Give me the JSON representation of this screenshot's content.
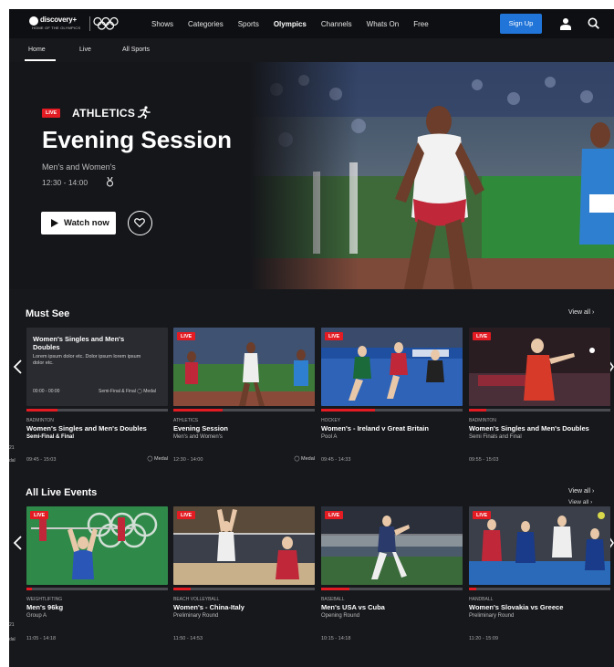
{
  "brand": {
    "name": "discovery+",
    "tagline": "HOME OF THE OLYMPICS"
  },
  "nav": {
    "links": [
      "Shows",
      "Categories",
      "Sports",
      "Olympics",
      "Channels",
      "Whats On",
      "Free"
    ],
    "active": "Olympics",
    "signup_label": "Sign Up"
  },
  "subnav": {
    "tabs": [
      "Home",
      "Live",
      "All Sports"
    ],
    "active": "Home"
  },
  "hero": {
    "live_label": "LIVE",
    "sport": "ATHLETICS",
    "title": "Evening Session",
    "subtitle": "Men's and Women's",
    "time": "12:30 - 14:00",
    "watch_label": "Watch now"
  },
  "must_see": {
    "title": "Must See",
    "view_all": "View all",
    "edge_left_texts": [
      "21",
      "dal"
    ],
    "cards": [
      {
        "live": false,
        "overlay_title": "Women's Singles and Men's Doubles",
        "overlay_desc": "Lorem ipsum dolor etc. Dolor ipsum lorem ipsum dolor etc.",
        "overlay_time": "00:00 - 00:00",
        "overlay_round": "Semi-Final & Final",
        "overlay_medal": "Medal",
        "sport": "BADMINTON",
        "title": "Women's Singles and Men's Doubles",
        "subtitle": "Semi-Final & Final",
        "time": "09:45 - 15:03",
        "medal": "Medal",
        "progress": 0.22
      },
      {
        "live": true,
        "live_label": "LIVE",
        "sport": "ATHLETICS",
        "title": "Evening Session",
        "subtitle": "Men's and Women's",
        "time": "12:30 - 14:00",
        "medal": "Medal",
        "progress": 0.35
      },
      {
        "live": true,
        "live_label": "LIVE",
        "sport": "HOCKEY",
        "title": "Women's - Ireland v Great Britain",
        "subtitle": "Pool A",
        "time": "09:45 - 14:33",
        "medal": "",
        "progress": 0.38
      },
      {
        "live": true,
        "live_label": "LIVE",
        "sport": "BADMINTON",
        "title": "Women's Singles and Men's Doubles",
        "subtitle": "Semi Finals and Final",
        "time": "09:55 - 15:03",
        "medal": "",
        "progress": 0.12
      }
    ]
  },
  "all_live": {
    "title": "All Live Events",
    "view_all": "View all",
    "view_all_ghost": "View all",
    "edge_left_texts": [
      "21",
      "dal"
    ],
    "cards": [
      {
        "live_label": "LIVE",
        "sport": "WEIGHTLIFTING",
        "title": "Men's 96kg",
        "subtitle": "Group A",
        "time": "11:05 - 14:18",
        "progress": 0.04
      },
      {
        "live_label": "LIVE",
        "sport": "BEACH VOLLEYBALL",
        "title": "Women's - China-Italy",
        "subtitle": "Preliminary Round",
        "time": "11:50 - 14:53",
        "progress": 0.12
      },
      {
        "live_label": "LIVE",
        "sport": "BASEBALL",
        "title": "Men's USA vs Cuba",
        "subtitle": "Opening Round",
        "time": "10:15 - 14:18",
        "progress": 0.2
      },
      {
        "live_label": "LIVE",
        "sport": "HANDBALL",
        "title": "Women's Slovakia vs Greece",
        "subtitle": "Preliminary Round",
        "time": "11:20 - 15:09",
        "progress": 0.05
      }
    ]
  },
  "colors": {
    "background": "#17181c",
    "live_red": "#e31b23",
    "signup_blue": "#2175d9",
    "progress_track": "#4a4b50"
  }
}
